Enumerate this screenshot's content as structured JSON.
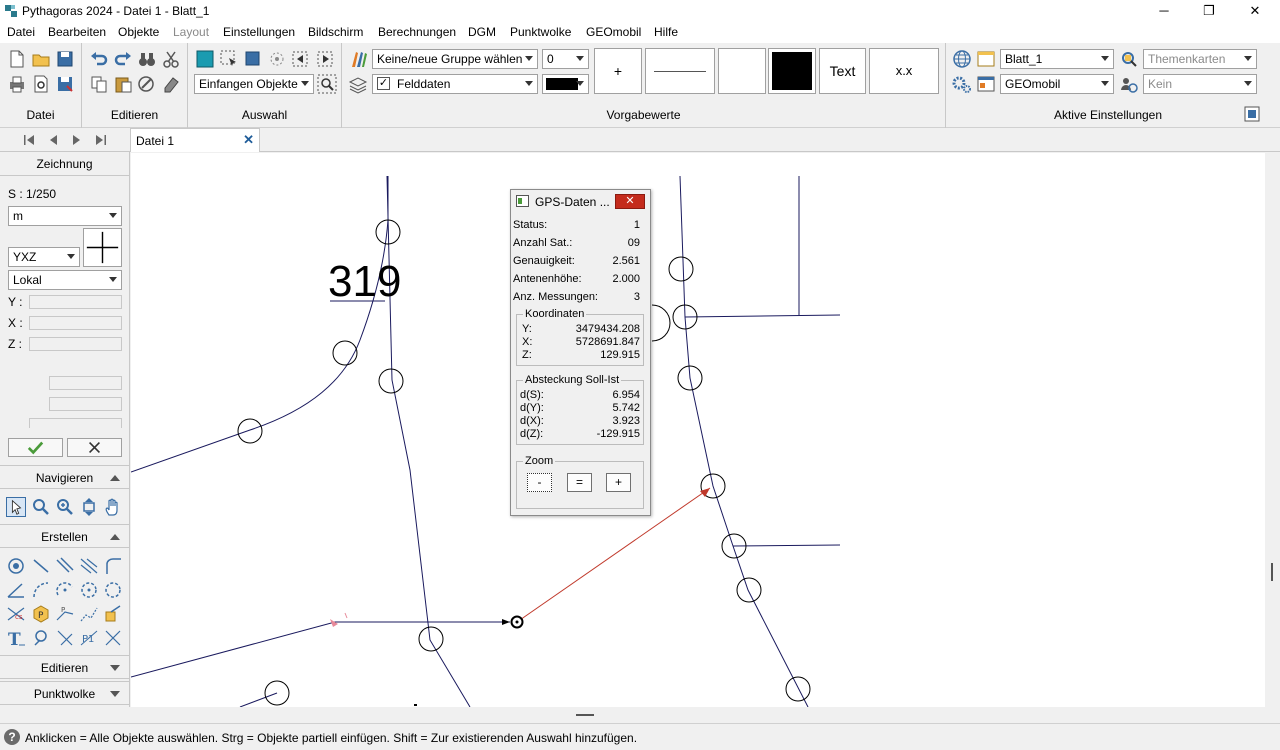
{
  "window": {
    "title": "Pythagoras 2024 - Datei 1 - Blatt_1",
    "minimize": "─",
    "maximize": "❐",
    "close": "✕"
  },
  "menu": [
    "Datei",
    "Bearbeiten",
    "Objekte",
    "Layout",
    "Einstellungen",
    "Bildschirm",
    "Berechnungen",
    "DGM",
    "Punktwolke",
    "GEOmobil",
    "Hilfe"
  ],
  "ribbon": {
    "groups": {
      "datei": "Datei",
      "editieren": "Editieren",
      "auswahl": "Auswahl",
      "vorgabewerte": "Vorgabewerte",
      "aktive": "Aktive Einstellungen"
    },
    "auswahl_select": "Einfangen Objekte",
    "group_select": "Keine/neue Gruppe wählen",
    "layer_select": "Felddaten",
    "layer_checked": true,
    "number_select": "0",
    "color_swatch": "#000000",
    "presets": {
      "plus": "+",
      "text": "Text",
      "decimal": "x.x"
    },
    "sheet_select": "Blatt_1",
    "theme_select": "Themenkarten",
    "mode_select": "GEOmobil",
    "kein_select": "Kein"
  },
  "tabs": {
    "doc": "Datei 1",
    "close": "✕"
  },
  "left_panel": {
    "section_zeichnung": "Zeichnung",
    "scale": "S : 1/250",
    "unit": "m",
    "axis": "YXZ",
    "coord_system": "Lokal",
    "y_label": "Y :",
    "x_label": "X :",
    "z_label": "Z :",
    "sections": {
      "navigieren": "Navigieren",
      "erstellen": "Erstellen",
      "editieren": "Editieren",
      "punktwolke": "Punktwolke"
    }
  },
  "canvas": {
    "parcel_number": "319"
  },
  "gps_dialog": {
    "title": "GPS-Daten ...",
    "close": "✕",
    "rows": [
      {
        "label": "Status:",
        "value": "1"
      },
      {
        "label": "Anzahl Sat.:",
        "value": "09"
      },
      {
        "label": "Genauigkeit:",
        "value": "2.561"
      },
      {
        "label": "Antenenhöhe:",
        "value": "2.000"
      },
      {
        "label": "Anz. Messungen:",
        "value": "3"
      }
    ],
    "koordinaten": {
      "legend": "Koordinaten",
      "y_label": "Y:",
      "y": "3479434.208",
      "x_label": "X:",
      "x": "5728691.847",
      "z_label": "Z:",
      "z": "129.915"
    },
    "absteckung": {
      "legend": "Absteckung Soll-Ist",
      "ds_label": "d(S):",
      "ds": "6.954",
      "dy_label": "d(Y):",
      "dy": "5.742",
      "dx_label": "d(X):",
      "dx": "3.923",
      "dz_label": "d(Z):",
      "dz": "-129.915"
    },
    "zoom": {
      "legend": "Zoom",
      "minus": "-",
      "equal": "=",
      "plus": "+"
    }
  },
  "status": {
    "icon": "?",
    "text": "Anklicken = Alle Objekte auswählen. Strg = Objekte partiell einfügen. Shift = Zur existierenden Auswahl hinzufügen."
  }
}
